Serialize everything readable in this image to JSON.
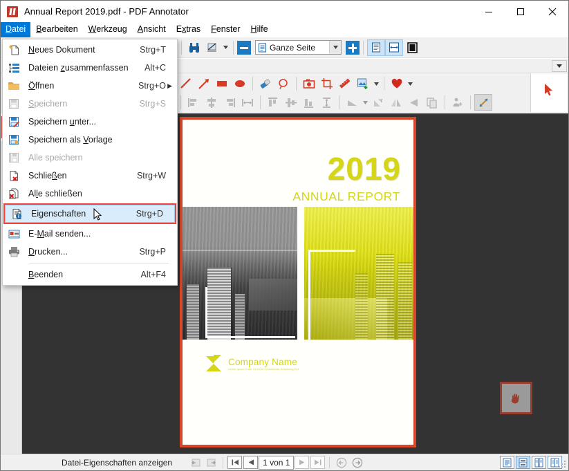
{
  "window": {
    "title": "Annual Report 2019.pdf - PDF Annotator",
    "app_icon": "pdf-annotator-icon",
    "minimize": "—",
    "maximize": "□",
    "close": "✕"
  },
  "menubar": {
    "items": [
      {
        "label": "Datei",
        "accesskey": "D",
        "active": true
      },
      {
        "label": "Bearbeiten",
        "accesskey": "B",
        "active": false
      },
      {
        "label": "Werkzeug",
        "accesskey": "W",
        "active": false
      },
      {
        "label": "Ansicht",
        "accesskey": "A",
        "active": false
      },
      {
        "label": "Extras",
        "accesskey": "x",
        "active": false
      },
      {
        "label": "Fenster",
        "accesskey": "F",
        "active": false
      },
      {
        "label": "Hilfe",
        "accesskey": "H",
        "active": false
      }
    ]
  },
  "file_menu": {
    "items": [
      {
        "label": "Neues Dokument",
        "accel": "Strg+T",
        "icon": "new-document-icon",
        "disabled": false,
        "submenu": false
      },
      {
        "label": "Dateien zusammenfassen",
        "accel": "Alt+C",
        "icon": "merge-files-icon",
        "disabled": false,
        "submenu": false
      },
      {
        "label": "Öffnen",
        "accel": "Strg+O",
        "icon": "open-folder-icon",
        "disabled": false,
        "submenu": true
      },
      {
        "label": "Speichern",
        "accel": "Strg+S",
        "icon": "save-icon",
        "disabled": true,
        "submenu": false
      },
      {
        "label": "Speichern unter...",
        "accel": "",
        "icon": "save-as-icon",
        "disabled": false,
        "submenu": false
      },
      {
        "label": "Speichern als Vorlage",
        "accel": "",
        "icon": "save-template-icon",
        "disabled": false,
        "submenu": false
      },
      {
        "label": "Alle speichern",
        "accel": "",
        "icon": "save-all-icon",
        "disabled": true,
        "submenu": false
      },
      {
        "label": "Schließen",
        "accel": "Strg+W",
        "icon": "close-document-icon",
        "disabled": false,
        "submenu": false
      },
      {
        "label": "Alle schließen",
        "accel": "",
        "icon": "close-all-icon",
        "disabled": false,
        "submenu": false
      },
      {
        "label": "Eigenschaften",
        "accel": "Strg+D",
        "icon": "properties-icon",
        "disabled": false,
        "submenu": false,
        "highlighted": true
      },
      {
        "label": "E-Mail senden...",
        "accel": "",
        "icon": "send-email-icon",
        "disabled": false,
        "submenu": false
      },
      {
        "label": "Drucken...",
        "accel": "Strg+P",
        "icon": "print-icon",
        "disabled": false,
        "submenu": false
      },
      {
        "label": "Beenden",
        "accel": "Alt+F4",
        "icon": "",
        "disabled": false,
        "submenu": false
      }
    ],
    "highlight_color": "#f4403a",
    "selection_fill": "#d8ecfb"
  },
  "toolbar_top": {
    "redo": "redo-icon",
    "find": "find-binoculars-icon",
    "chart": "chart-tool-icon",
    "zoom_out": "zoom-out-button",
    "zoom_in": "zoom-in-button",
    "zoom_value": "Ganze Seite",
    "zoom_dropdown_arrow": "chevron-down-icon",
    "fit_page": "fit-page-icon",
    "fit_width": "fit-width-icon",
    "single_page": "single-page-icon"
  },
  "toolbar_annotate": {
    "row1": [
      "pen-line-icon",
      "arrow-icon",
      "rectangle-icon",
      "ellipse-icon",
      "eraser-icon",
      "lasso-icon",
      "camera-icon",
      "crop-icon",
      "ruler-icon",
      "stamp-image-icon",
      "stamp-dropdown-arrow",
      "heart-stamp-icon",
      "heart-dropdown-arrow"
    ],
    "row2": [
      "align-left-icon",
      "align-center-h-icon",
      "align-right-icon",
      "distribute-h-icon",
      "align-top-icon",
      "align-middle-v-icon",
      "align-bottom-icon",
      "distribute-v-icon",
      "rotate-free-icon",
      "rotate-dropdown-arrow",
      "rotate-right-icon",
      "flip-vertical-icon",
      "flip-horizontal-icon",
      "duplicate-icon",
      "group-icon",
      "resize-icon"
    ],
    "picker": "pointer-select-icon",
    "overflow": "toolbar-overflow-arrow"
  },
  "left_tools": {
    "items": [
      {
        "icon": "heart-stamp-tool",
        "selected": true
      },
      {
        "icon": "pen-tool"
      },
      {
        "icon": "highlighter-tool"
      },
      {
        "icon": "text-tool"
      },
      {
        "icon": "stamp-tool"
      },
      {
        "icon": "arrow-tool"
      }
    ]
  },
  "document": {
    "page": {
      "year": "2019",
      "subtitle": "ANNUAL REPORT",
      "company_name": "Company Name",
      "company_tagline": "Lorem Ipsum Dolor Sit Amet Consectetur Adipiscing Elit",
      "accent_color": "#d4d617",
      "border_color": "#d9472b"
    },
    "hand_badge": "pan-hand-icon",
    "canvas_background": "#333333"
  },
  "statusbar": {
    "message": "Datei-Eigenschaften anzeigen",
    "prev_view": "back-view-icon",
    "next_view": "forward-view-icon",
    "first_page": "first-page-icon",
    "prev_page": "previous-page-icon",
    "page_indicator": "1 von 1",
    "next_page": "next-page-icon",
    "last_page": "last-page-icon",
    "nav_back": "history-back-icon",
    "nav_forward": "history-forward-icon",
    "view_modes": [
      {
        "icon": "view-single-icon",
        "active": false
      },
      {
        "icon": "view-continuous-icon",
        "active": true
      },
      {
        "icon": "view-facing-icon",
        "active": false
      },
      {
        "icon": "view-grid-icon",
        "active": false
      }
    ],
    "resize_grip": "resize-grip-icon"
  }
}
